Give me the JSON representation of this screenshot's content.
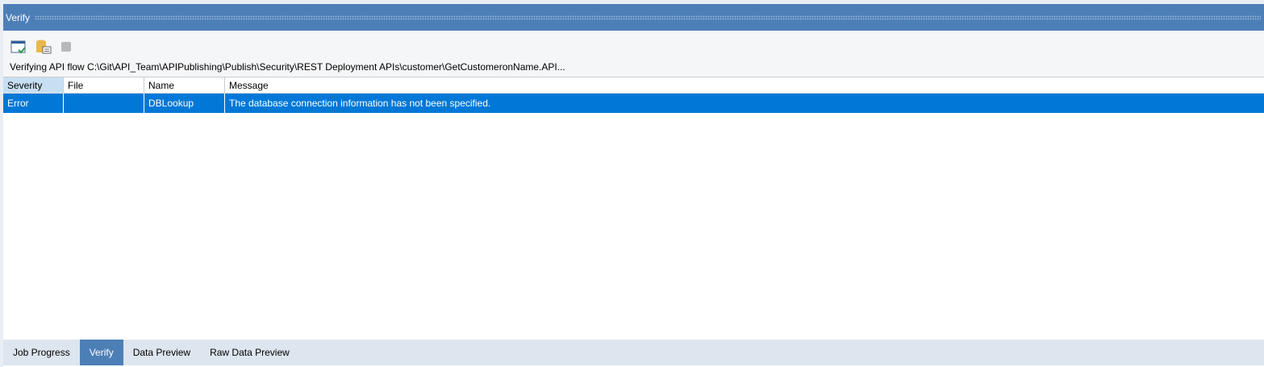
{
  "panel": {
    "title": "Verify"
  },
  "status": "Verifying API flow C:\\Git\\API_Team\\APIPublishing\\Publish\\Security\\REST Deployment APIs\\customer\\GetCustomeronName.API...",
  "columns": [
    "Severity",
    "File",
    "Name",
    "Message"
  ],
  "rows": [
    {
      "severity": "Error",
      "file": "",
      "name": "DBLookup",
      "message": "The database connection information has not been specified."
    }
  ],
  "tabs": [
    "Job Progress",
    "Verify",
    "Data Preview",
    "Raw Data Preview"
  ],
  "active_tab": "Verify"
}
